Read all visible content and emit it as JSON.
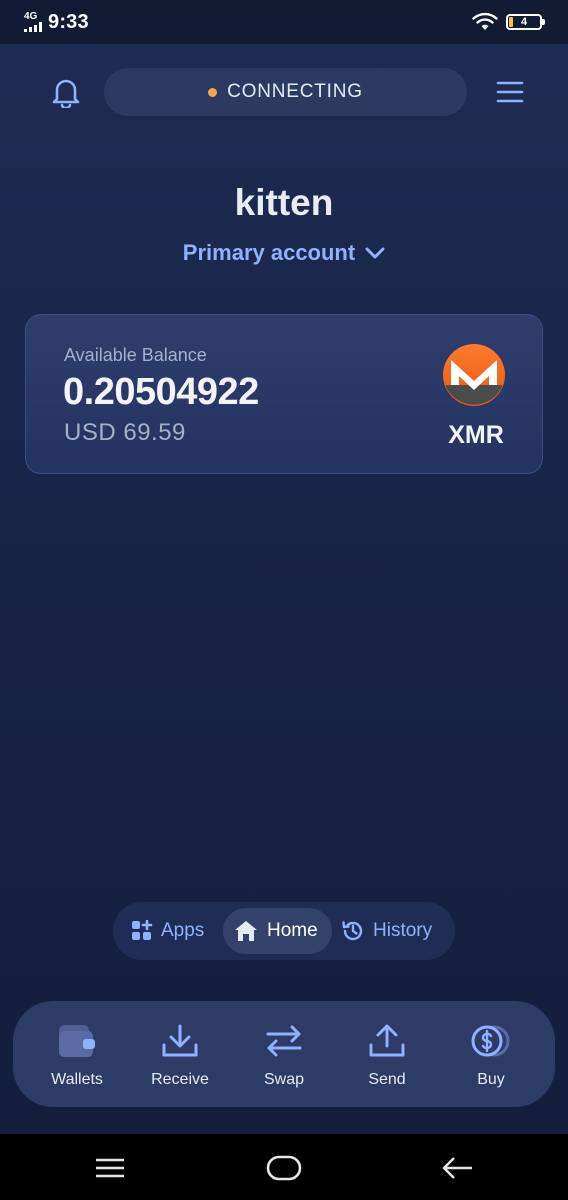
{
  "status_bar": {
    "network": "4G",
    "time": "9:33",
    "battery": "4"
  },
  "header": {
    "connection_status": "CONNECTING",
    "status_color": "#f5a94a"
  },
  "wallet": {
    "name": "kitten",
    "account": "Primary account"
  },
  "balance_card": {
    "caption": "Available Balance",
    "amount": "0.20504922",
    "fiat": "USD 69.59",
    "currency": "XMR",
    "currency_icon": "monero-logo",
    "brand_color": "#f26822"
  },
  "nav": {
    "apps": "Apps",
    "home": "Home",
    "history": "History",
    "active": "Home"
  },
  "actions": {
    "wallets": "Wallets",
    "receive": "Receive",
    "swap": "Swap",
    "send": "Send",
    "buy": "Buy"
  },
  "accent_color": "#8fb2ff"
}
